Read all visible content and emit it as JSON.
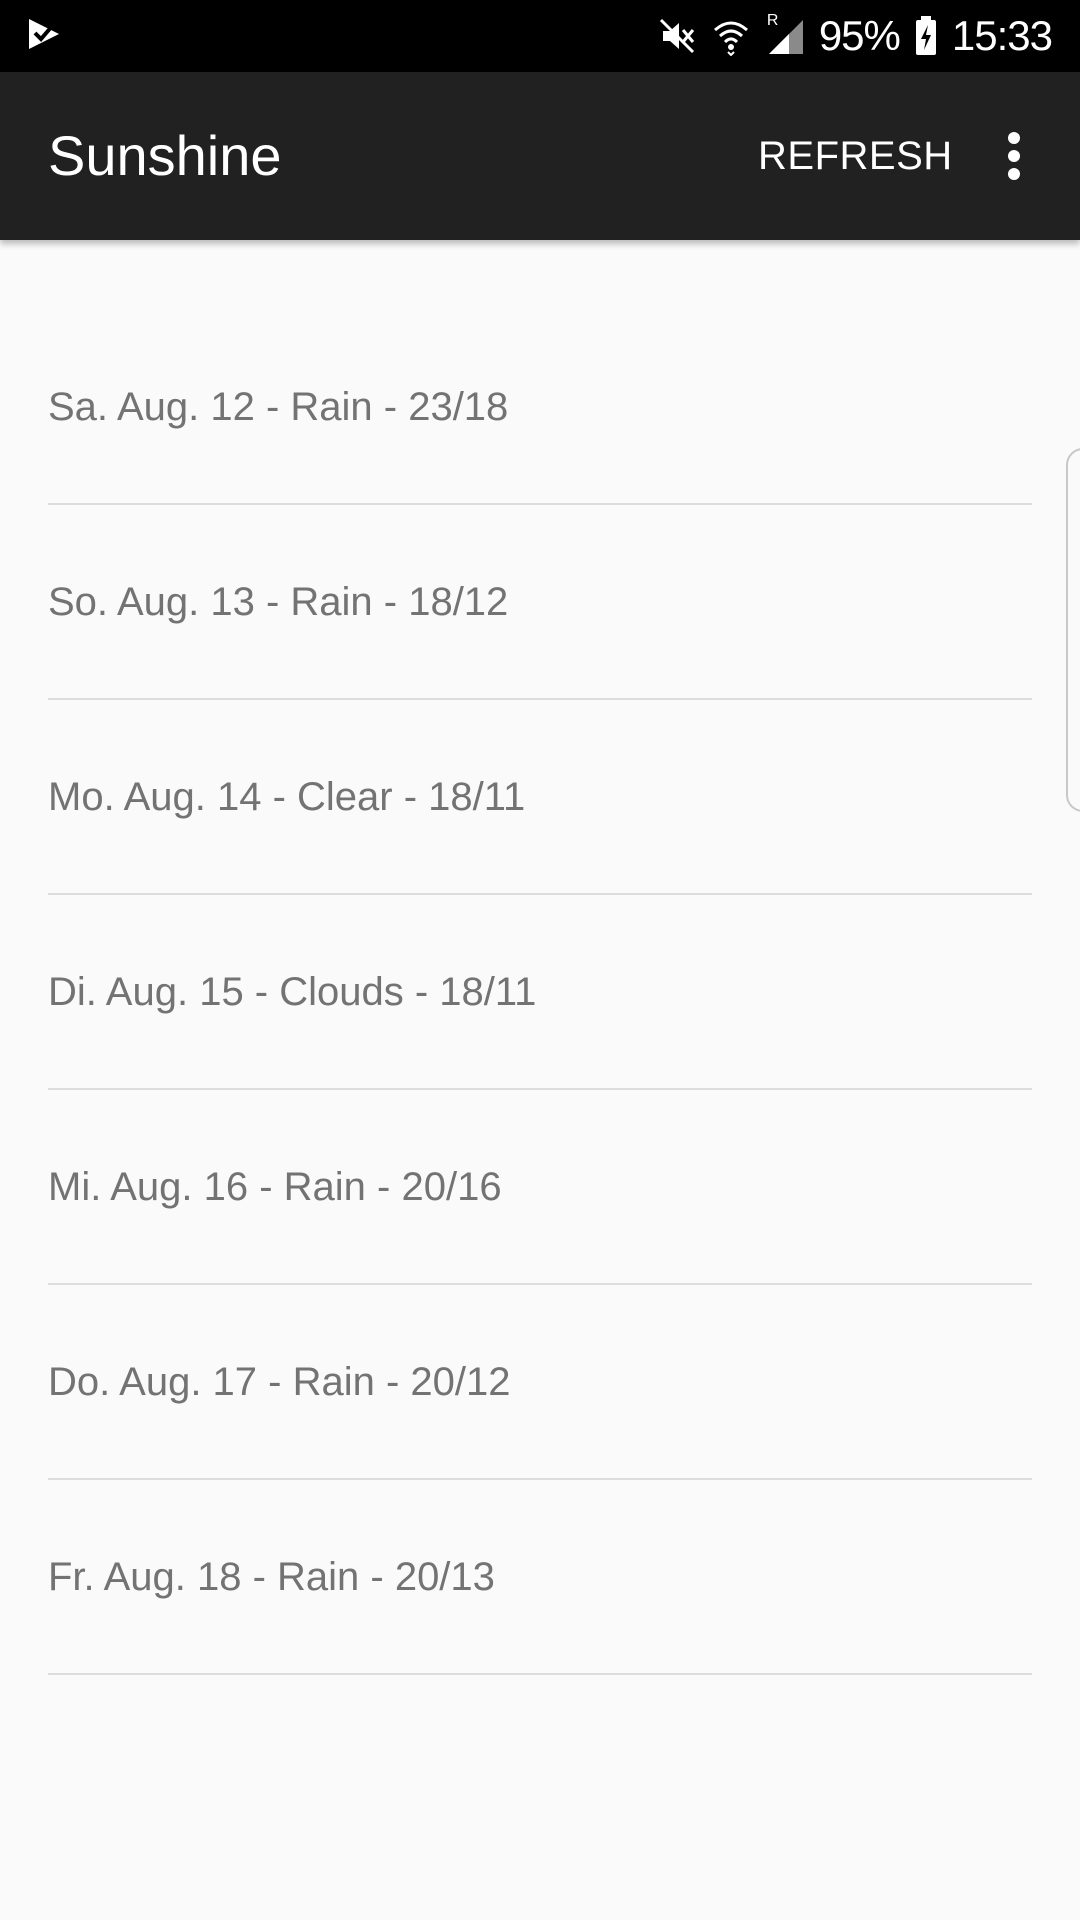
{
  "status_bar": {
    "battery": "95%",
    "time": "15:33",
    "roaming_label": "R"
  },
  "toolbar": {
    "title": "Sunshine",
    "refresh_label": "REFRESH"
  },
  "forecast": {
    "items": [
      {
        "label": "Sa. Aug. 12 - Rain - 23/18"
      },
      {
        "label": "So. Aug. 13 - Rain - 18/12"
      },
      {
        "label": "Mo. Aug. 14 - Clear - 18/11"
      },
      {
        "label": "Di. Aug. 15 - Clouds - 18/11"
      },
      {
        "label": "Mi. Aug. 16 - Rain - 20/16"
      },
      {
        "label": "Do. Aug. 17 - Rain - 20/12"
      },
      {
        "label": "Fr. Aug. 18 - Rain - 20/13"
      }
    ]
  },
  "icons": {
    "status_left": "check-badge-icon",
    "mute": "mute-icon",
    "wifi": "wifi-icon",
    "signal": "signal-icon",
    "battery": "battery-charging-icon",
    "overflow": "more-vert-icon"
  },
  "colors": {
    "toolbar_bg": "#212121",
    "status_bg": "#000000",
    "list_text": "#737373",
    "divider": "#dddddd"
  }
}
